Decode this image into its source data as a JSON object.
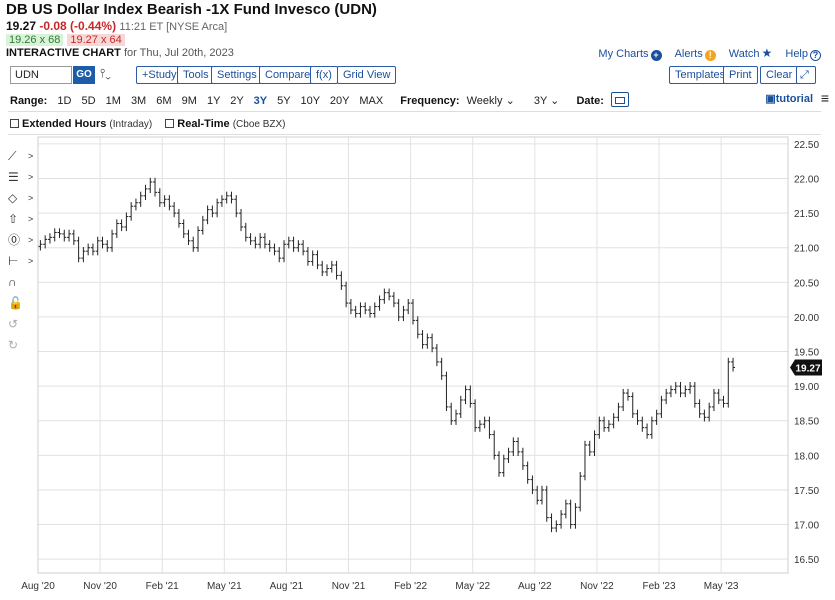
{
  "header": {
    "title": "DB US Dollar Index Bearish -1X Fund Invesco (UDN)",
    "last": "19.27",
    "change": "-0.08 (-0.44%)",
    "time_exchange": "11:21 ET [NYSE Arca]",
    "bid": "19.26 x 68",
    "ask": "19.27 x 64",
    "interactive_label": "INTERACTIVE CHART",
    "interactive_date": "for Thu, Jul 20th, 2023"
  },
  "top_links": {
    "my_charts": "My Charts",
    "alerts": "Alerts",
    "watch": "Watch",
    "help": "Help"
  },
  "toolbar": {
    "symbol": "UDN",
    "go": "GO",
    "study": "+Study",
    "tools": "Tools",
    "settings": "Settings",
    "compare": "Compare",
    "fx": "f(x)",
    "grid_view": "Grid View",
    "templates": "Templates",
    "print": "Print",
    "clear": "Clear",
    "expand_icon": "expand-icon"
  },
  "range_bar": {
    "range_label": "Range:",
    "ranges": [
      "1D",
      "5D",
      "1M",
      "3M",
      "6M",
      "9M",
      "1Y",
      "2Y",
      "3Y",
      "5Y",
      "10Y",
      "20Y",
      "MAX"
    ],
    "active_range": "3Y",
    "frequency_label": "Frequency:",
    "frequency": "Weekly",
    "period": "3Y",
    "date_label": "Date:",
    "tutorial": "tutorial"
  },
  "options": {
    "extended_hours": "Extended Hours",
    "extended_hours_note": "(Intraday)",
    "real_time": "Real-Time",
    "real_time_note": "(Cboe BZX)"
  },
  "colors": {
    "link_blue": "#1a4f9c",
    "down_red": "#c62828",
    "up_green": "#2e7d32",
    "bar": "#222222",
    "grid": "#e2e2e2"
  },
  "chart_data": {
    "type": "ohlc",
    "title": "",
    "xlabel": "",
    "ylabel": "",
    "ylim": [
      16.3,
      22.6
    ],
    "yticks": [
      "22.50",
      "22.00",
      "21.50",
      "21.00",
      "20.50",
      "20.00",
      "19.50",
      "19.00",
      "18.50",
      "18.00",
      "17.50",
      "17.00",
      "16.50"
    ],
    "xticks": [
      {
        "label": "Aug '20",
        "week": 0
      },
      {
        "label": "Nov '20",
        "week": 13
      },
      {
        "label": "Feb '21",
        "week": 26
      },
      {
        "label": "May '21",
        "week": 39
      },
      {
        "label": "Aug '21",
        "week": 52
      },
      {
        "label": "Nov '21",
        "week": 65
      },
      {
        "label": "Feb '22",
        "week": 78
      },
      {
        "label": "May '22",
        "week": 91
      },
      {
        "label": "Aug '22",
        "week": 104
      },
      {
        "label": "Nov '22",
        "week": 117
      },
      {
        "label": "Feb '23",
        "week": 130
      },
      {
        "label": "May '23",
        "week": 143
      }
    ],
    "x_range": [
      0,
      157
    ],
    "grid": true,
    "last_price_label": "19.27",
    "last_price": 19.27,
    "weekly_close": [
      21.05,
      21.12,
      21.15,
      21.22,
      21.2,
      21.15,
      21.2,
      21.1,
      20.85,
      20.95,
      21.0,
      20.95,
      21.1,
      21.05,
      21.0,
      21.2,
      21.35,
      21.3,
      21.45,
      21.6,
      21.65,
      21.75,
      21.85,
      21.95,
      21.8,
      21.65,
      21.7,
      21.6,
      21.5,
      21.35,
      21.2,
      21.1,
      21.0,
      21.25,
      21.4,
      21.55,
      21.5,
      21.65,
      21.7,
      21.75,
      21.7,
      21.5,
      21.3,
      21.15,
      21.1,
      21.05,
      21.15,
      21.05,
      21.0,
      20.95,
      20.85,
      21.05,
      21.1,
      21.0,
      21.05,
      20.95,
      20.8,
      20.9,
      20.75,
      20.65,
      20.7,
      20.75,
      20.6,
      20.45,
      20.2,
      20.1,
      20.05,
      20.15,
      20.1,
      20.05,
      20.15,
      20.25,
      20.35,
      20.3,
      20.2,
      20.0,
      20.1,
      20.2,
      19.95,
      19.75,
      19.6,
      19.7,
      19.55,
      19.35,
      19.15,
      18.7,
      18.5,
      18.6,
      18.8,
      18.95,
      18.75,
      18.4,
      18.45,
      18.5,
      18.3,
      18.0,
      17.75,
      17.95,
      18.05,
      18.2,
      18.05,
      17.85,
      17.65,
      17.5,
      17.35,
      17.5,
      17.1,
      16.95,
      17.0,
      17.15,
      17.3,
      17.0,
      17.25,
      17.7,
      18.15,
      18.05,
      18.3,
      18.5,
      18.4,
      18.45,
      18.55,
      18.7,
      18.9,
      18.85,
      18.6,
      18.5,
      18.4,
      18.3,
      18.5,
      18.6,
      18.8,
      18.9,
      18.95,
      19.0,
      18.9,
      18.95,
      19.0,
      18.75,
      18.6,
      18.55,
      18.7,
      18.9,
      18.8,
      18.75,
      19.35,
      19.27
    ]
  }
}
